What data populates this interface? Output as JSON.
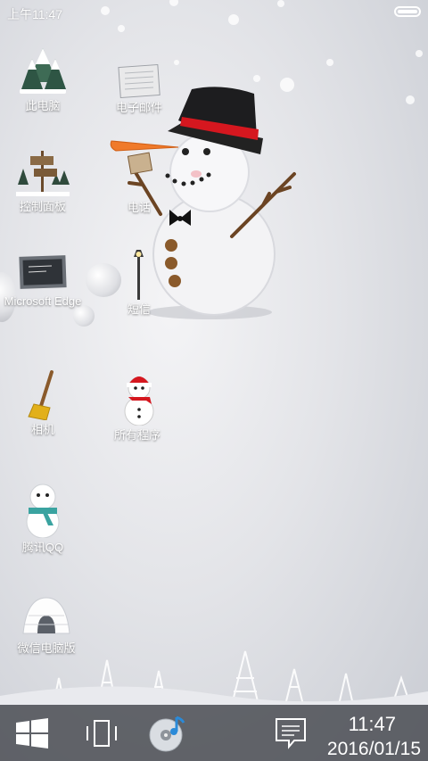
{
  "status_bar": {
    "time": "上午11:47"
  },
  "desktop": {
    "icons": [
      {
        "label": "此电脑"
      },
      {
        "label": "电子邮件"
      },
      {
        "label": "控制面板"
      },
      {
        "label": "电话"
      },
      {
        "label": "Microsoft Edge"
      },
      {
        "label": "短信"
      },
      {
        "label": "相机"
      },
      {
        "label": "所有程序"
      },
      {
        "label": "腾讯QQ"
      },
      {
        "label": "微信电脑版"
      }
    ]
  },
  "taskbar": {
    "start_icon": "windows-logo-icon",
    "task_view_icon": "task-view-icon",
    "media_icon": "music-disc-icon",
    "notification_icon": "action-center-icon",
    "time": "11:47",
    "date": "2016/01/15"
  },
  "colors": {
    "taskbar_bg": "#46484e",
    "accent_red": "#d0202a",
    "text": "#ffffff"
  }
}
